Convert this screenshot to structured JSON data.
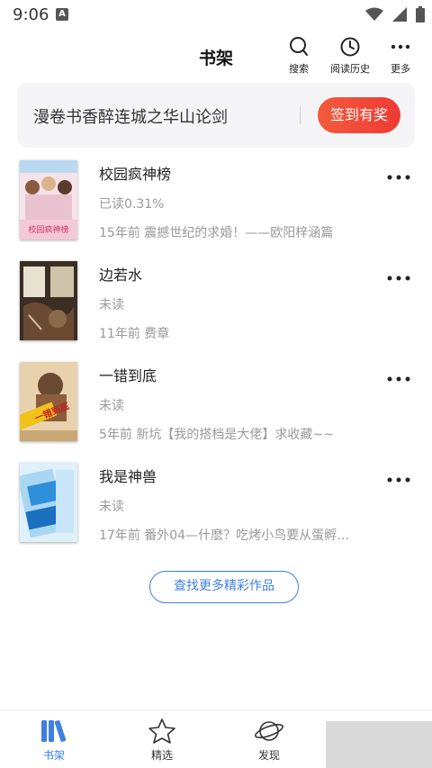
{
  "status_bar": {
    "time": "9:06",
    "notification_badge": "A",
    "icons": [
      "wifi-icon",
      "signal-icon",
      "battery-icon"
    ]
  },
  "header": {
    "title": "书架",
    "actions": [
      {
        "label": "搜索",
        "icon": "search-icon"
      },
      {
        "label": "阅读历史",
        "icon": "clock-icon"
      },
      {
        "label": "更多",
        "icon": "more-dots-icon"
      }
    ]
  },
  "banner": {
    "promo_text": "漫卷书香醉连城之华山论剑",
    "signin_label": "签到有奖",
    "signin_color": "#f0453a"
  },
  "books": [
    {
      "title": "校园疯神榜",
      "progress": "已读0.31%",
      "latest": "15年前 震撼世纪的求婚！——欧阳梓涵篇",
      "cover_text": "校园疯神榜"
    },
    {
      "title": "边若水",
      "progress": "未读",
      "latest": "11年前 费章"
    },
    {
      "title": "一错到底",
      "progress": "未读",
      "latest": "5年前 新坑【我的搭档是大佬】求收藏~~",
      "cover_text": "一错到底"
    },
    {
      "title": "我是神兽",
      "progress": "未读",
      "latest": "17年前 番外04—什麽？吃烤小鸟要从蛋孵…"
    }
  ],
  "find_more_label": "查找更多精彩作品",
  "accent_color": "#3f7fe0",
  "bottom_nav": {
    "items": [
      {
        "label": "书架",
        "icon": "bookshelf-icon",
        "active": true
      },
      {
        "label": "精选",
        "icon": "star-icon",
        "active": false
      },
      {
        "label": "发现",
        "icon": "planet-icon",
        "active": false
      }
    ]
  }
}
